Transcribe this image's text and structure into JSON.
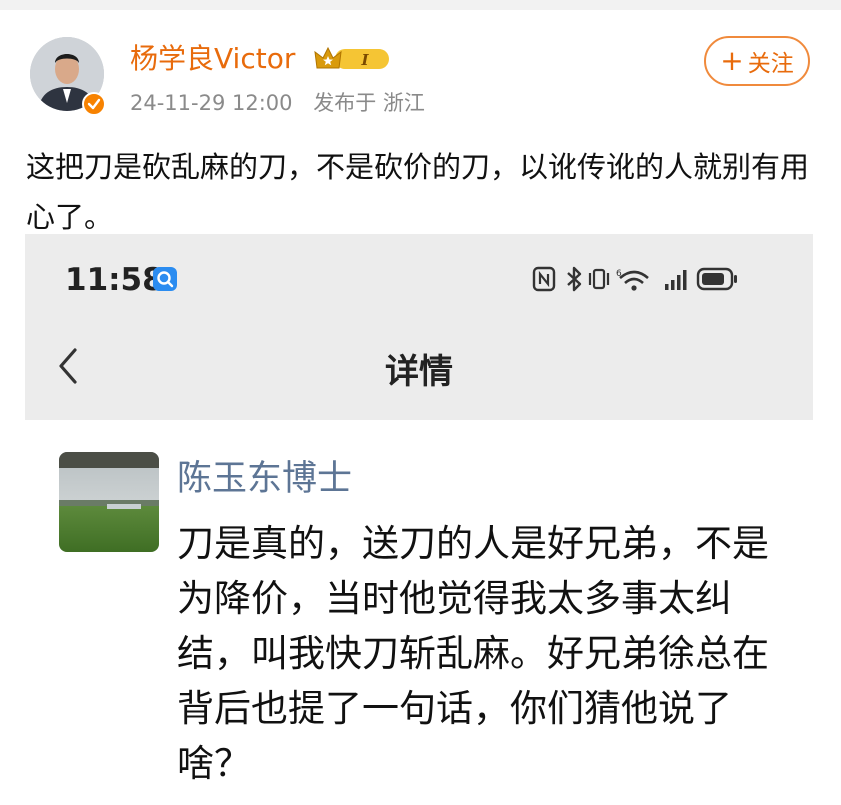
{
  "post": {
    "author": "杨学良Victor",
    "vip_badge_text": "I",
    "date": "24-11-29 12:00",
    "location": "发布于 浙江",
    "follow_label": "关注",
    "follow_plus": "+",
    "text": "这把刀是砍乱麻的刀，不是砍价的刀，以讹传讹的人就别有用心了。"
  },
  "screenshot": {
    "status_time": "11:58",
    "page_title": "详情",
    "comment": {
      "author": "陈玉东博士",
      "text": "刀是真的，送刀的人是好兄弟，不是为降价，当时他觉得我太多事太纠结，叫我快刀斩乱麻。好兄弟徐总在背后也提了一句话，你们猜他说了啥？"
    }
  },
  "colors": {
    "author_orange": "#e86b0c",
    "verified_orange": "#f78200",
    "commenter_blue": "#5d7595",
    "meta_gray": "#8a8a8a"
  },
  "icons": [
    "verified-icon",
    "vip-crown-icon",
    "search-app-icon",
    "nfc-icon",
    "bluetooth-icon",
    "vibrate-icon",
    "wifi-icon",
    "signal-icon",
    "battery-icon",
    "back-arrow-icon"
  ]
}
